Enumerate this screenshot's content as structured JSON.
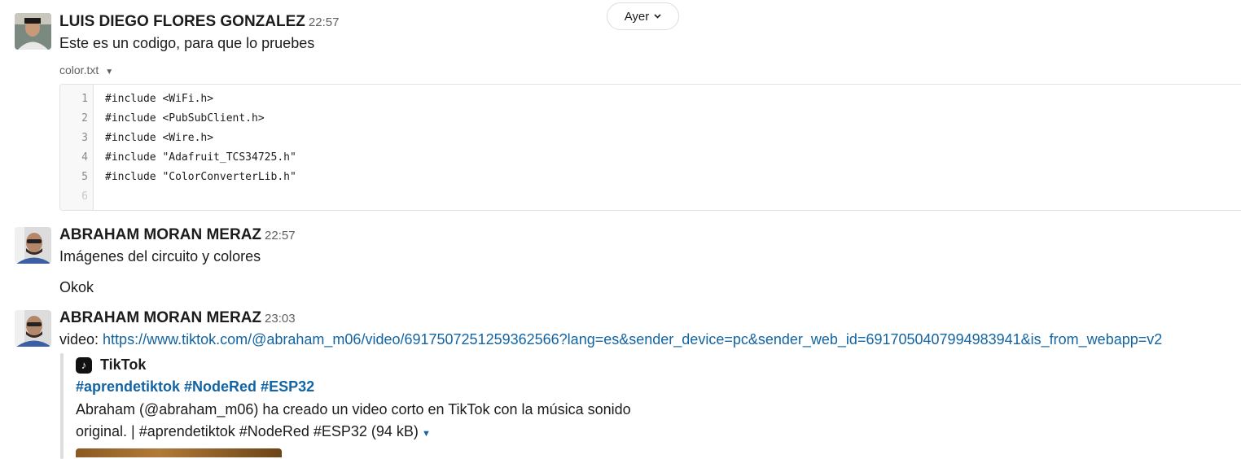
{
  "day_divider": {
    "label": "Ayer"
  },
  "messages": [
    {
      "author": "LUIS DIEGO FLORES GONZALEZ",
      "time": "22:57",
      "text": "Este es un codigo, para que lo pruebes",
      "file": {
        "name": "color.txt",
        "line_numbers": [
          "1",
          "2",
          "3",
          "4",
          "5",
          "6"
        ],
        "lines": [
          "#include <WiFi.h>",
          "#include <PubSubClient.h>",
          "#include <Wire.h>",
          "#include \"Adafruit_TCS34725.h\"",
          "#include \"ColorConverterLib.h\"",
          ""
        ]
      }
    },
    {
      "author": "ABRAHAM MORAN MERAZ",
      "time": "22:57",
      "lines": [
        "Imágenes del circuito y colores",
        "Okok"
      ]
    },
    {
      "author": "ABRAHAM MORAN MERAZ",
      "time": "23:03",
      "prefix": "video: ",
      "url": "https://www.tiktok.com/@abraham_m06/video/6917507251259362566?lang=es&sender_device=pc&sender_web_id=6917050407994983941&is_from_webapp=v2",
      "unfurl": {
        "service": "TikTok",
        "title": "#aprendetiktok #NodeRed #ESP32",
        "desc_line1": "Abraham (@abraham_m06) ha creado un video corto en TikTok con la música sonido",
        "desc_line2": "original. | #aprendetiktok #NodeRed #ESP32 (94 kB)"
      }
    }
  ]
}
